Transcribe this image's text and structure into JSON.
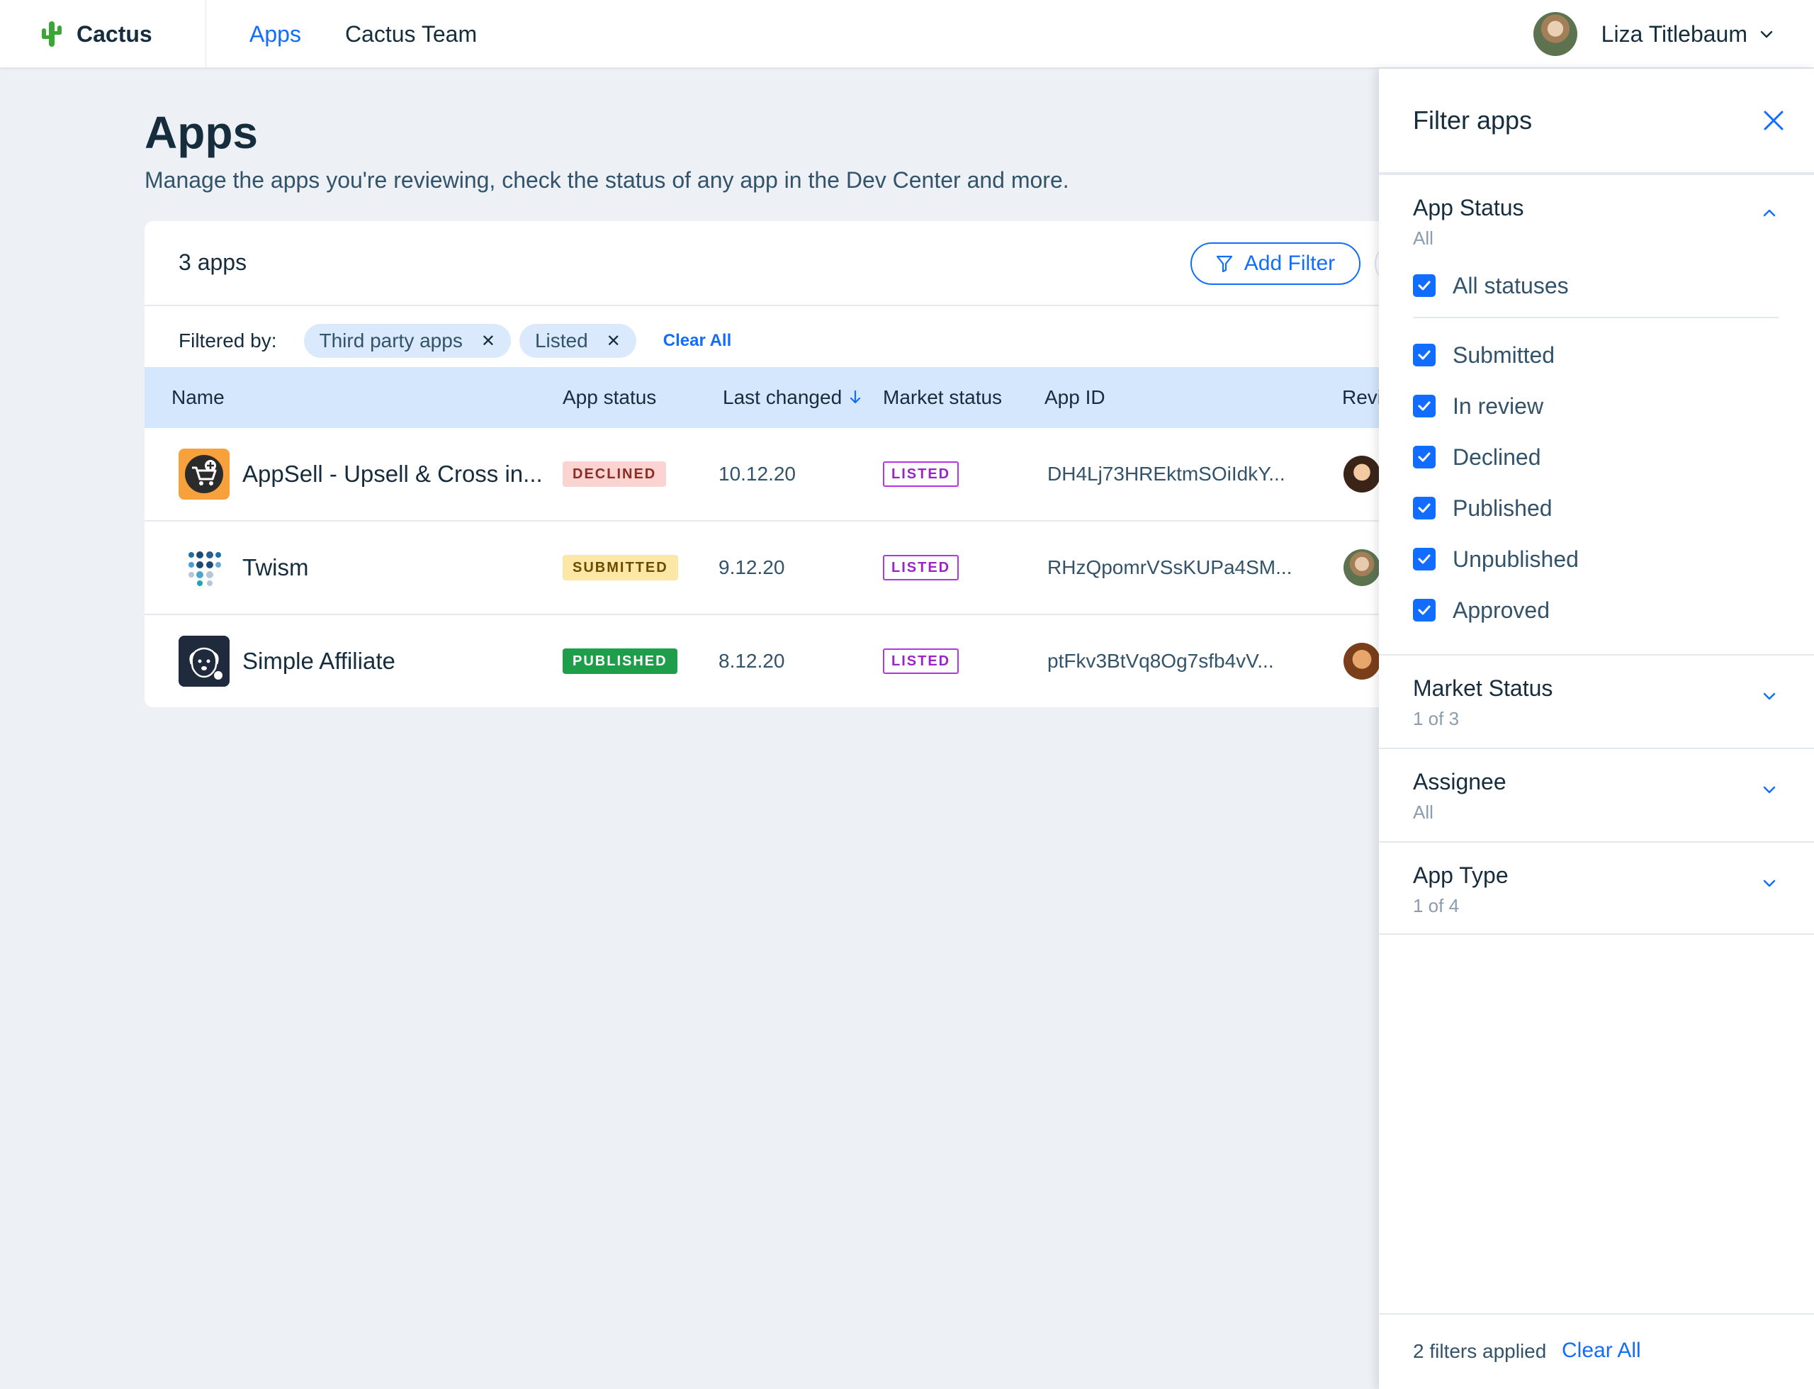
{
  "topbar": {
    "brand_name": "Cactus",
    "brand_color": "#3aa635",
    "nav": [
      {
        "label": "Apps",
        "active": true
      },
      {
        "label": "Cactus Team",
        "active": false
      }
    ],
    "user_name": "Liza Titlebaum"
  },
  "page": {
    "title": "Apps",
    "subtitle": "Manage the apps you're reviewing, check the status of any app in the Dev Center and more."
  },
  "table": {
    "count_label": "3 apps",
    "add_filter_label": "Add Filter",
    "filtered_by_label": "Filtered by:",
    "chips": [
      "Third party apps",
      "Listed"
    ],
    "clear_all_label": "Clear All",
    "columns": [
      "Name",
      "App status",
      "Last changed",
      "Market status",
      "App ID",
      "Revi"
    ],
    "sort_column": "Last changed",
    "rows": [
      {
        "name": "AppSell - Upsell & Cross in...",
        "status": "DECLINED",
        "last_changed": "10.12.20",
        "market_status": "LISTED",
        "app_id": "DH4Lj73HREktmSOiIdkY...",
        "icon": "appsell-cart-icon"
      },
      {
        "name": "Twism",
        "status": "SUBMITTED",
        "last_changed": "9.12.20",
        "market_status": "LISTED",
        "app_id": "RHzQpomrVSsKUPa4SM...",
        "icon": "twism-dots-icon"
      },
      {
        "name": "Simple Affiliate",
        "status": "PUBLISHED",
        "last_changed": "8.12.20",
        "market_status": "LISTED",
        "app_id": "ptFkv3BtVq8Og7sfb4vV...",
        "icon": "dog-logo-icon"
      }
    ]
  },
  "filter_panel": {
    "title": "Filter apps",
    "app_status": {
      "title": "App Status",
      "summary": "All",
      "all_label": "All statuses",
      "options": [
        "Submitted",
        "In review",
        "Declined",
        "Published",
        "Unpublished",
        "Approved"
      ]
    },
    "market_status": {
      "title": "Market Status",
      "summary": "1 of 3"
    },
    "assignee": {
      "title": "Assignee",
      "summary": "All"
    },
    "app_type": {
      "title": "App Type",
      "summary": "1 of 4"
    },
    "footer_text": "2 filters applied",
    "footer_clear": "Clear All"
  }
}
